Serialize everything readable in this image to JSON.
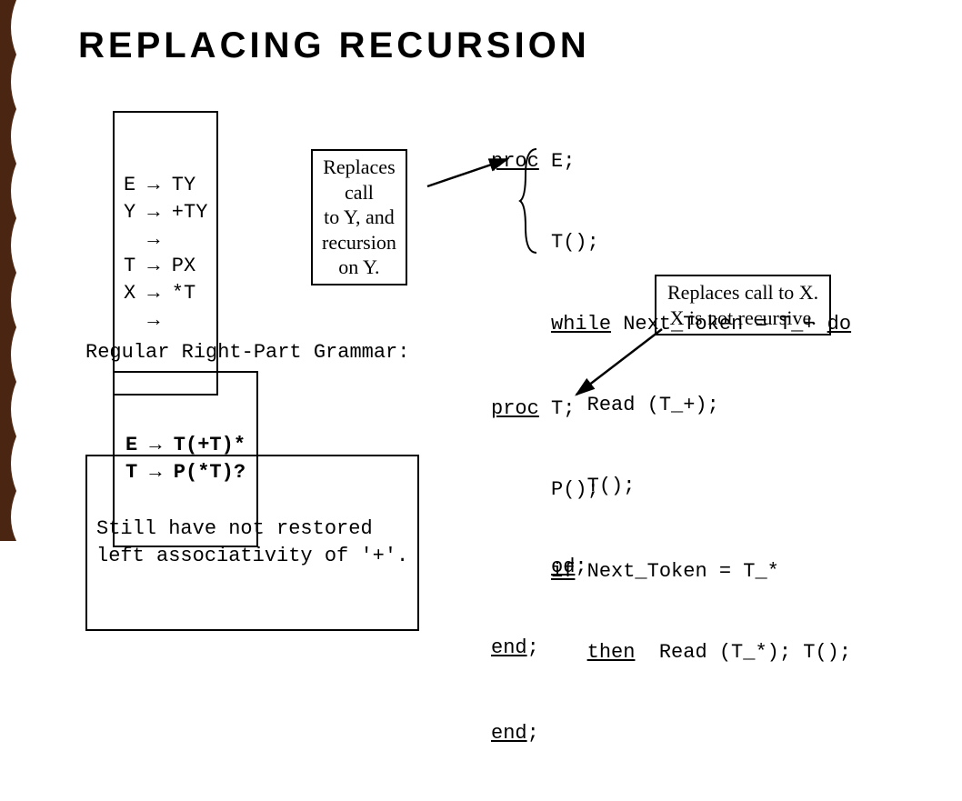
{
  "title": "REPLACING RECURSION",
  "grammar": "E → TY\nY → +TY\n  →\nT → PX\nX → *T\n  →",
  "replaces_y": "Replaces\ncall\nto Y, and\nrecursion\non Y.",
  "code_e": {
    "l1a": "proc",
    "l1b": " E;",
    "l2": "     T();",
    "l3a": "     ",
    "l3b": "while",
    "l3c": " Next_Token = T_+ ",
    "l3d": "do",
    "l4": "        Read (T_+);",
    "l5": "        T();",
    "l6a": "     ",
    "l6b": "od",
    "l6c": ";",
    "l7a": "end",
    "l7b": ";"
  },
  "replaces_x": "Replaces call to X.\nX is not recursive.",
  "rrpg_label": "Regular Right-Part Grammar:",
  "rrpg": "E → T(+T)*\nT → P(*T)?",
  "still": "Still have not restored\nleft associativity of '+'.",
  "code_t": {
    "l1a": "proc",
    "l1b": " T;",
    "l2": "     P();",
    "l3a": "     ",
    "l3b": "if",
    "l3c": " Next_Token = T_*",
    "l4a": "        ",
    "l4b": "then",
    "l4c": "  Read (T_*); T();",
    "l5a": "end",
    "l5b": ";"
  }
}
